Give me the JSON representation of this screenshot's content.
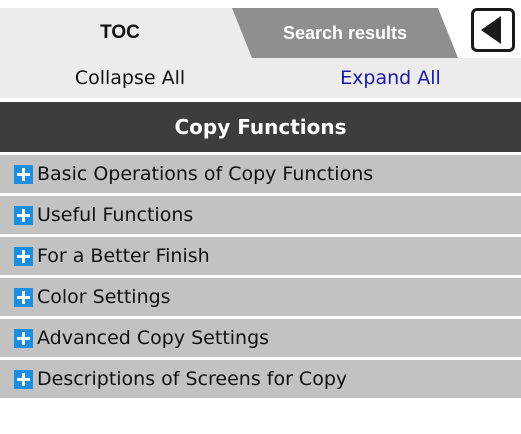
{
  "tabs": {
    "toc_label": "TOC",
    "search_label": "Search results"
  },
  "actions": {
    "collapse_label": "Collapse All",
    "expand_label": "Expand All"
  },
  "section": {
    "title": "Copy Functions"
  },
  "toc_items": [
    {
      "label": "Basic Operations of Copy Functions",
      "icon": "plus-icon"
    },
    {
      "label": "Useful Functions",
      "icon": "plus-icon"
    },
    {
      "label": "For a Better Finish",
      "icon": "plus-icon"
    },
    {
      "label": "Color Settings",
      "icon": "plus-icon"
    },
    {
      "label": "Advanced Copy Settings",
      "icon": "plus-icon"
    },
    {
      "label": "Descriptions of Screens for Copy",
      "icon": "plus-icon"
    }
  ],
  "colors": {
    "section_header_bg": "#3d3d3d",
    "item_bg": "#c2c2c2",
    "plus_icon": "#1d8de0",
    "expand_link": "#1a1aa6",
    "search_tab_bg": "#8f8f8f"
  }
}
